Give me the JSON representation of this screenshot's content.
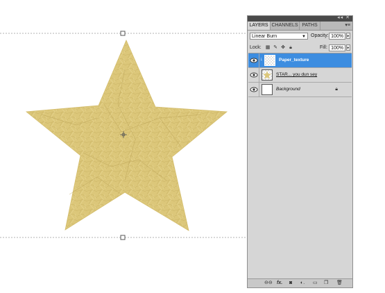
{
  "panel": {
    "tabs": [
      "LAYERS",
      "CHANNELS",
      "PATHS"
    ],
    "active_tab": "LAYERS",
    "tab_menu_glyph": "▾≡",
    "titlebar_controls": "◂◂ ✕",
    "blend_mode": "Linear Burn",
    "opacity_label": "Opacity:",
    "opacity_value": "100%",
    "lock_label": "Lock:",
    "fill_label": "Fill:",
    "fill_value": "100%",
    "layers": [
      {
        "name": "Paper_texture",
        "selected": true,
        "visible": true,
        "clipped": true
      },
      {
        "name": "STAR... you dun sey",
        "selected": false,
        "visible": true,
        "clipped": false
      },
      {
        "name": "Background",
        "selected": false,
        "visible": true,
        "clipped": false,
        "locked": true
      }
    ]
  },
  "colors": {
    "star": "#dcc77a",
    "selection": "#3d8de0",
    "panel_bg": "#d6d6d6"
  },
  "icons": {
    "lock_transparency": "checker-icon",
    "lock_image": "brush-icon",
    "lock_position": "move-icon",
    "lock_all": "lock-icon",
    "footer": [
      "link-icon",
      "fx-icon",
      "mask-icon",
      "adjustment-icon",
      "group-icon",
      "new-layer-icon",
      "trash-icon"
    ]
  }
}
